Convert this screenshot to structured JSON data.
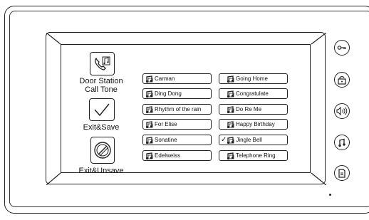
{
  "side_panel": {
    "call_tone_label": [
      "Door Station",
      "Call Tone"
    ],
    "exit_save_label": "Exit&Save",
    "exit_unsave_label": "Exit&Unsave"
  },
  "tones": {
    "left": [
      "Carman",
      "Ding Dong",
      "Rhythm of the rain",
      "For Elise",
      "Sonatine",
      "Edelweiss"
    ],
    "right": [
      "Going Home",
      "Congratulate",
      "Do Re Me",
      "Happy Birthday",
      "Jingle Bell",
      "Telephone Ring"
    ]
  },
  "selected_tone": "Jingle Bell",
  "hardware_buttons": [
    "key-icon",
    "unlock-icon",
    "volume-icon",
    "ringtone-icon",
    "record-icon"
  ]
}
